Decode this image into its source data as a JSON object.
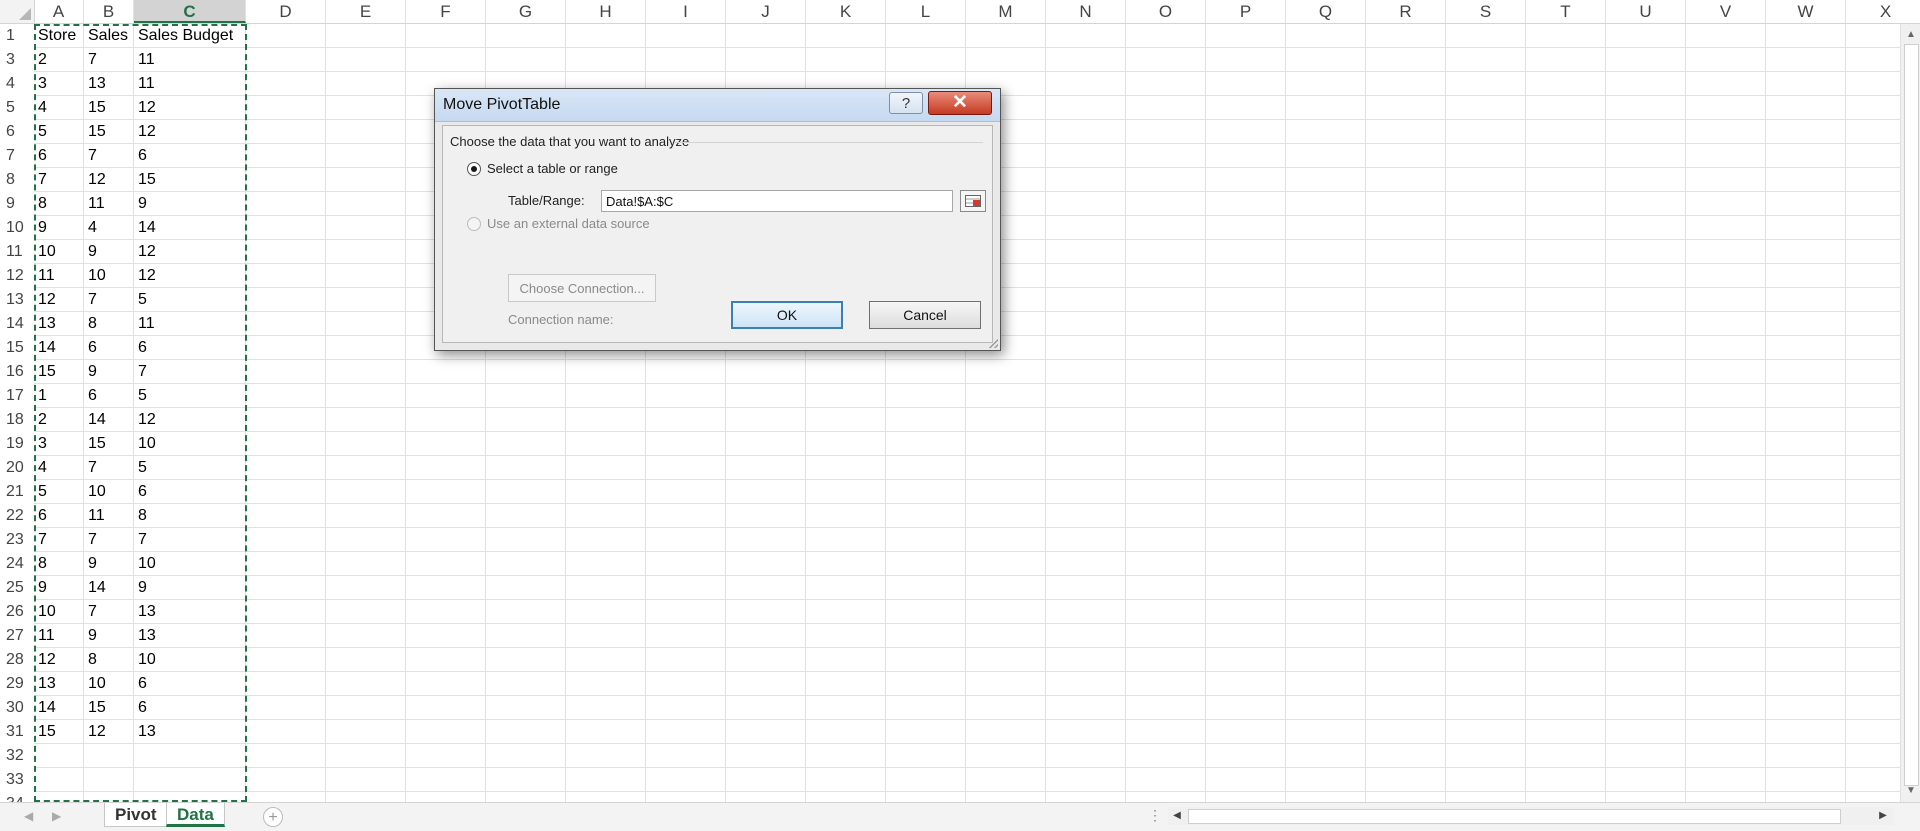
{
  "spreadsheet": {
    "columns": [
      "A",
      "B",
      "C",
      "D",
      "E",
      "F",
      "G",
      "H",
      "I",
      "J",
      "K",
      "L",
      "M",
      "N",
      "O",
      "P",
      "Q",
      "R",
      "S",
      "T",
      "U",
      "V",
      "W",
      "X"
    ],
    "selected_column": "C",
    "row_numbers": [
      "1",
      "3",
      "4",
      "5",
      "6",
      "7",
      "8",
      "9",
      "10",
      "11",
      "12",
      "13",
      "14",
      "15",
      "16",
      "17",
      "18",
      "19",
      "20",
      "21",
      "22",
      "23",
      "24",
      "25",
      "26",
      "27",
      "28",
      "29",
      "30",
      "31",
      "32",
      "33",
      "34"
    ],
    "headers": [
      "Store",
      "Sales",
      "Sales Budget"
    ],
    "rows": [
      [
        "2",
        "7",
        "11"
      ],
      [
        "3",
        "13",
        "11"
      ],
      [
        "4",
        "15",
        "12"
      ],
      [
        "5",
        "15",
        "12"
      ],
      [
        "6",
        "7",
        "6"
      ],
      [
        "7",
        "12",
        "15"
      ],
      [
        "8",
        "11",
        "9"
      ],
      [
        "9",
        "4",
        "14"
      ],
      [
        "10",
        "9",
        "12"
      ],
      [
        "11",
        "10",
        "12"
      ],
      [
        "12",
        "7",
        "5"
      ],
      [
        "13",
        "8",
        "11"
      ],
      [
        "14",
        "6",
        "6"
      ],
      [
        "15",
        "9",
        "7"
      ],
      [
        "1",
        "6",
        "5"
      ],
      [
        "2",
        "14",
        "12"
      ],
      [
        "3",
        "15",
        "10"
      ],
      [
        "4",
        "7",
        "5"
      ],
      [
        "5",
        "10",
        "6"
      ],
      [
        "6",
        "11",
        "8"
      ],
      [
        "7",
        "7",
        "7"
      ],
      [
        "8",
        "9",
        "10"
      ],
      [
        "9",
        "14",
        "9"
      ],
      [
        "10",
        "7",
        "13"
      ],
      [
        "11",
        "9",
        "13"
      ],
      [
        "12",
        "8",
        "10"
      ],
      [
        "13",
        "10",
        "6"
      ],
      [
        "14",
        "15",
        "6"
      ],
      [
        "15",
        "12",
        "13"
      ]
    ]
  },
  "sheet_tabs": [
    {
      "label": "Pivot",
      "active": false
    },
    {
      "label": "Data",
      "active": true
    }
  ],
  "dialog": {
    "title": "Move PivotTable",
    "help_label": "?",
    "close_label": "✕",
    "section_label": "Choose the data that you want to analyze",
    "option_table_label": "Select a table or range",
    "table_range_label": "Table/Range:",
    "table_range_value": "Data!$A:$C",
    "option_external_label": "Use an external data source",
    "choose_connection_label": "Choose Connection...",
    "connection_name_label": "Connection name:",
    "ok_label": "OK",
    "cancel_label": "Cancel"
  },
  "colors": {
    "accent": "#217346",
    "dialog_title": "#c5d9f0",
    "close_button": "#c63a22"
  },
  "icons": {
    "collapse": "range-collapse-icon",
    "add_sheet": "plus-icon",
    "nav": "chevron-icon"
  }
}
